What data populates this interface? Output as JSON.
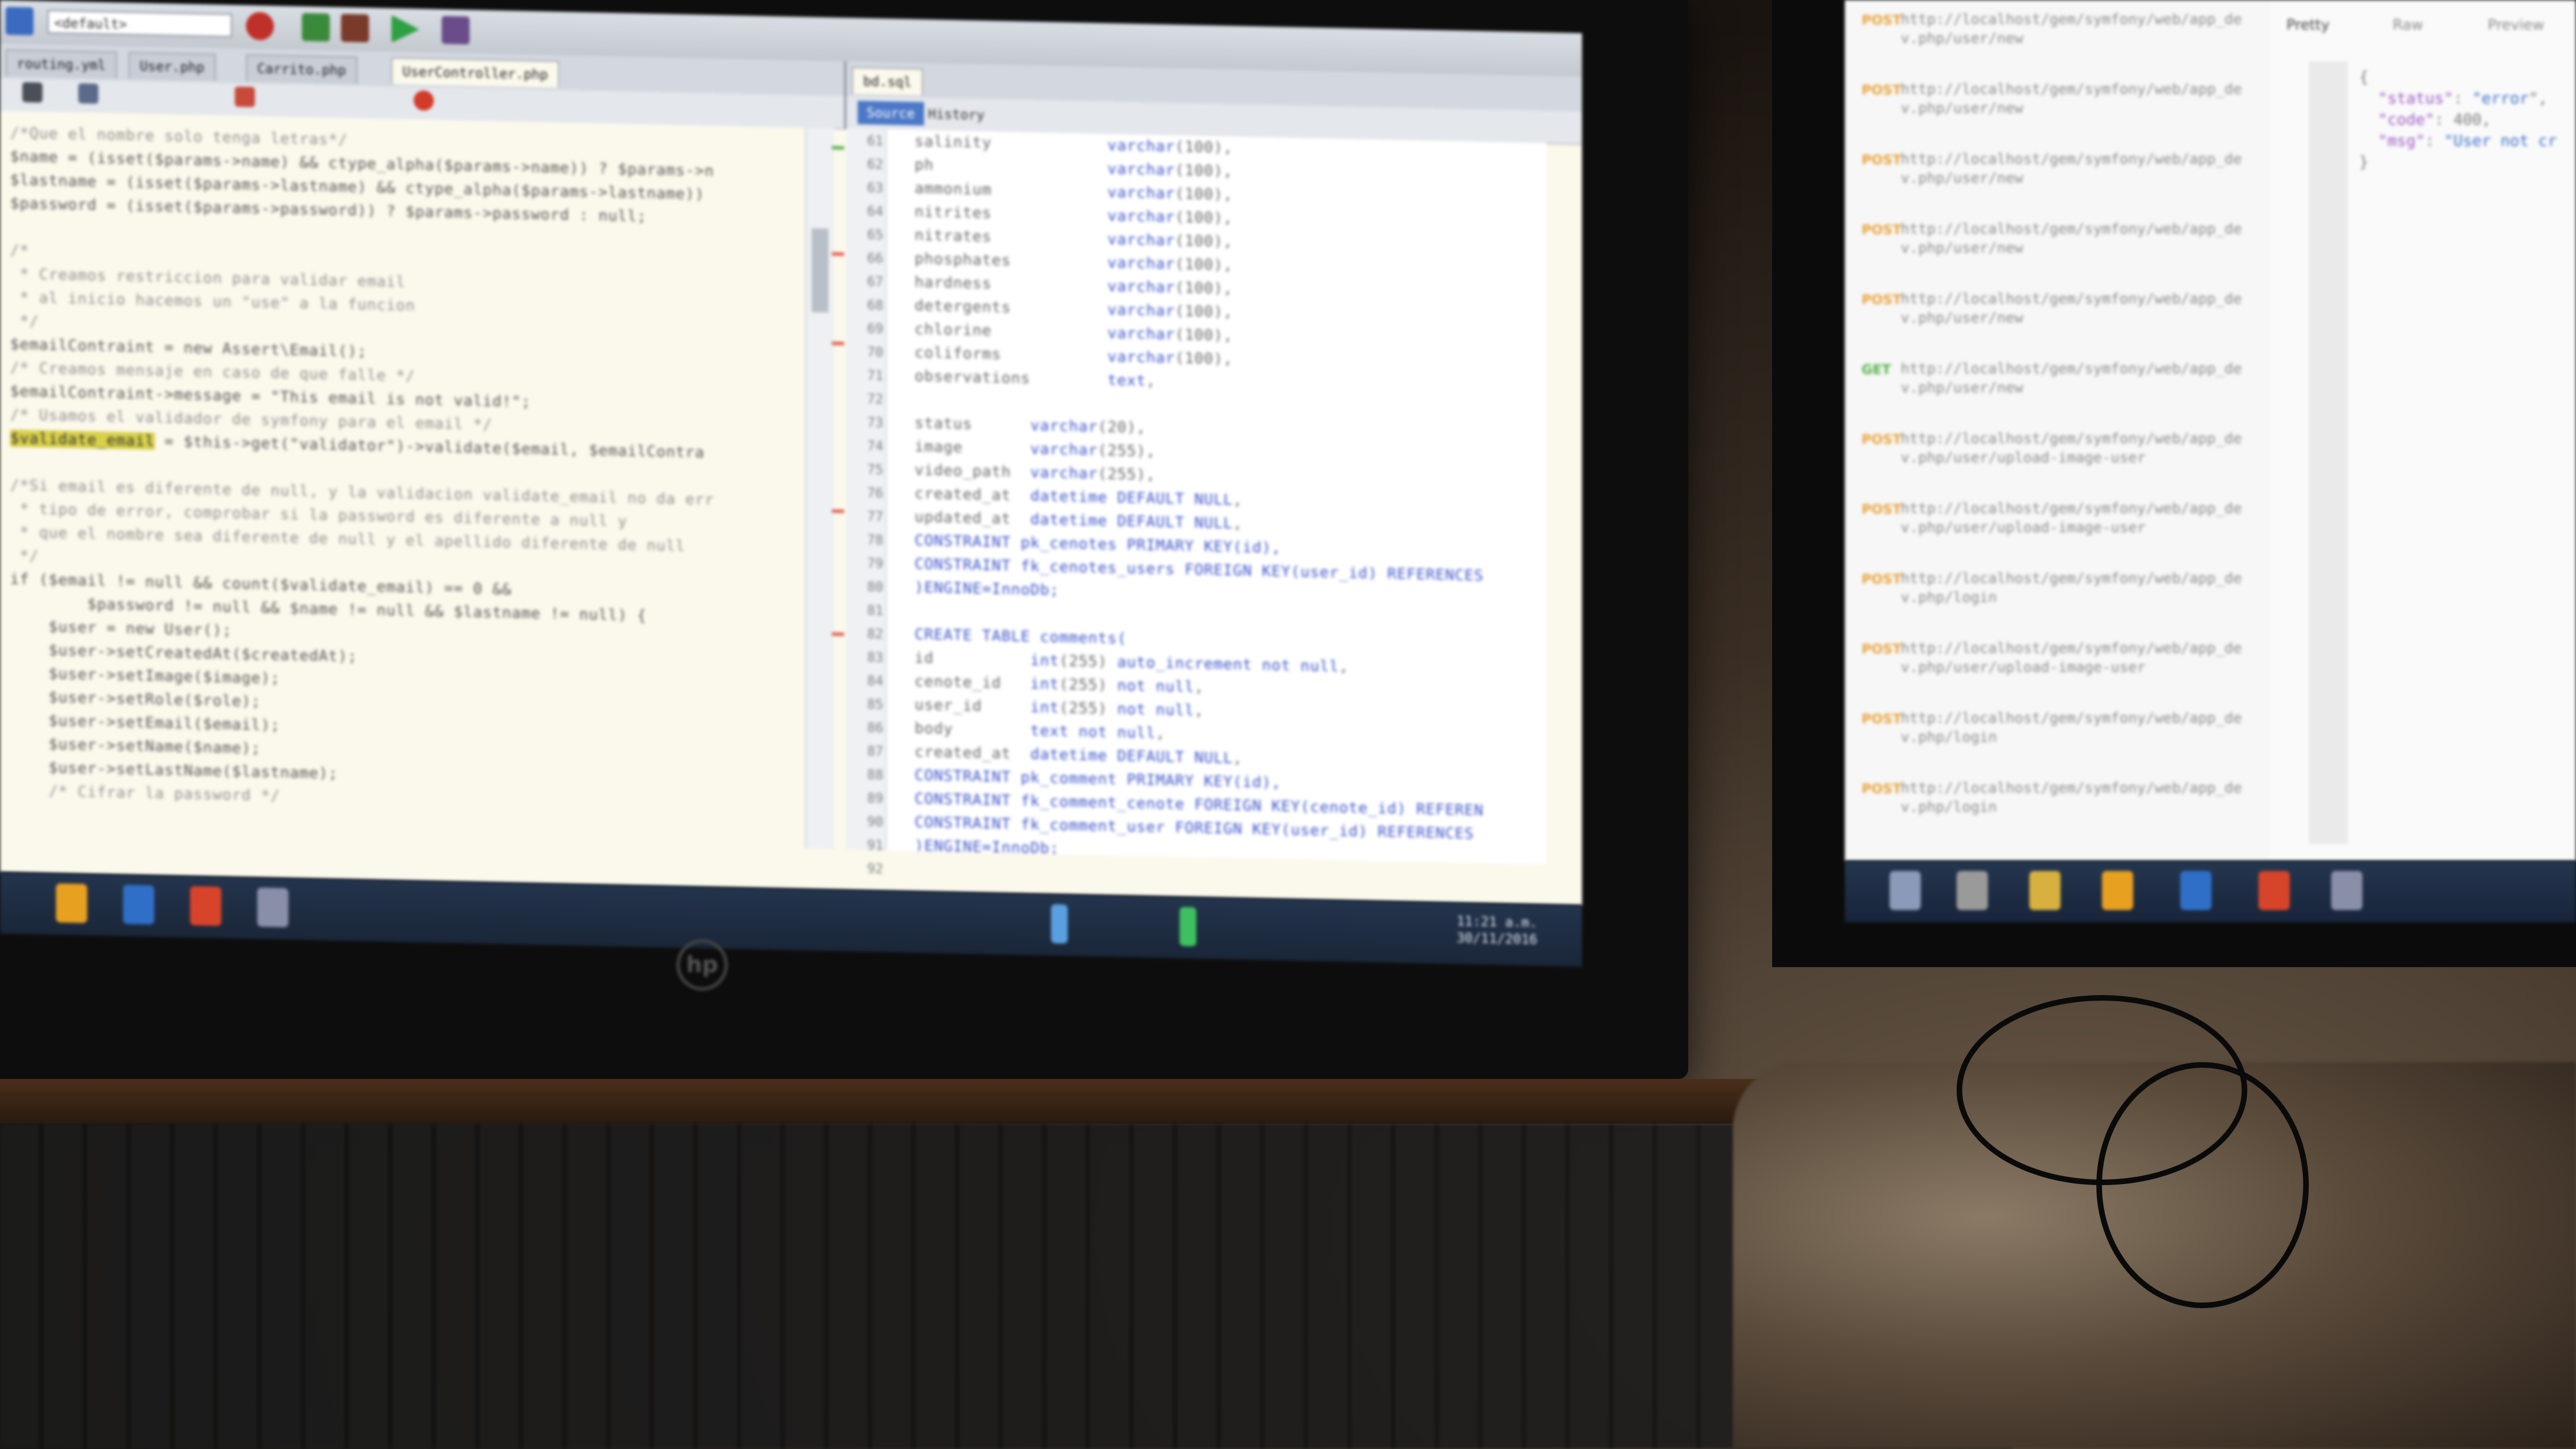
{
  "left_ide": {
    "toolbar": {
      "config_combo": "<default>"
    },
    "editor_tabs": [
      "routing.yml",
      "User.php",
      "Carrito.php",
      "UserController.php"
    ],
    "right_tab": "bd.sql",
    "subtabs": {
      "source": "Source",
      "history": "History"
    },
    "php_code": [
      {
        "text": "/*Que el nombre solo tenga letras*/",
        "style": "comment"
      },
      {
        "text": "$name = (isset($params->name) && ctype_alpha($params->name)) ? $params->n",
        "style": "plain"
      },
      {
        "text": "$lastname = (isset($params->lastname) && ctype_alpha($params->lastname))",
        "style": "plain"
      },
      {
        "text": "$password = (isset($params->password)) ? $params->password : null;",
        "style": "plain"
      },
      {
        "text": "",
        "style": "plain"
      },
      {
        "text": "/*",
        "style": "comment"
      },
      {
        "text": " * Creamos restriccion para validar email",
        "style": "comment"
      },
      {
        "text": " * al inicio hacemos un \"use\" a la funcion",
        "style": "comment"
      },
      {
        "text": " */",
        "style": "comment"
      },
      {
        "text": "$emailContraint = new Assert\\Email();",
        "style": "plain"
      },
      {
        "text": "/* Creamos mensaje en caso de que falle */",
        "style": "comment"
      },
      {
        "text": "$emailContraint->message = \"This email is not valid!\";",
        "style": "plain"
      },
      {
        "text": "/* Usamos el validador de symfony para el email */",
        "style": "comment"
      },
      {
        "text": "$validate_email = $this->get(\"validator\")->validate($email, $emailContra",
        "style": "plain"
      },
      {
        "text": "",
        "style": "plain"
      },
      {
        "text": "/*Si email es diferente de null, y la validacion validate_email no da err",
        "style": "comment"
      },
      {
        "text": " * tipo de error, comprobar si la password es diferente a null y",
        "style": "comment"
      },
      {
        "text": " * que el nombre sea diferente de null y el apellido diferente de null",
        "style": "comment"
      },
      {
        "text": " */",
        "style": "comment"
      },
      {
        "text": "if ($email != null && count($validate_email) == 0 &&",
        "style": "plain"
      },
      {
        "text": "        $password != null && $name != null && $lastname != null) {",
        "style": "plain"
      },
      {
        "text": "    $user = new User();",
        "style": "plain"
      },
      {
        "text": "    $user->setCreatedAt($createdAt);",
        "style": "plain"
      },
      {
        "text": "    $user->setImage($image);",
        "style": "plain"
      },
      {
        "text": "    $user->setRole($role);",
        "style": "plain"
      },
      {
        "text": "    $user->setEmail($email);",
        "style": "plain"
      },
      {
        "text": "    $user->setName($name);",
        "style": "plain"
      },
      {
        "text": "    $user->setLastName($lastname);",
        "style": "plain"
      },
      {
        "text": "    /* Cifrar la password */",
        "style": "comment"
      }
    ],
    "sql_line_numbers": [
      "61",
      "62",
      "63",
      "64",
      "65",
      "66",
      "67",
      "68",
      "69",
      "70",
      "71",
      "72",
      "73",
      "74",
      "75",
      "76",
      "77",
      "78",
      "79",
      "80",
      "81",
      "82",
      "83",
      "84",
      "85",
      "86",
      "87",
      "88",
      "89",
      "90",
      "91",
      "92"
    ],
    "sql_code": [
      "salinity            varchar(100),",
      "ph                  varchar(100),",
      "ammonium            varchar(100),",
      "nitrites            varchar(100),",
      "nitrates            varchar(100),",
      "phosphates          varchar(100),",
      "hardness            varchar(100),",
      "detergents          varchar(100),",
      "chlorine            varchar(100),",
      "coliforms           varchar(100),",
      "observations        text,",
      "",
      "status      varchar(20),",
      "image       varchar(255),",
      "video_path  varchar(255),",
      "created_at  datetime DEFAULT NULL,",
      "updated_at  datetime DEFAULT NULL,",
      "CONSTRAINT pk_cenotes PRIMARY KEY(id),",
      "CONSTRAINT fk_cenotes_users FOREIGN KEY(user_id) REFERENCES",
      ")ENGINE=InnoDb;",
      "",
      "CREATE TABLE comments(",
      "id          int(255) auto_increment not null,",
      "cenote_id   int(255) not null,",
      "user_id     int(255) not null,",
      "body        text not null,",
      "created_at  datetime DEFAULT NULL,",
      "CONSTRAINT pk_comment PRIMARY KEY(id),",
      "CONSTRAINT fk_comment_cenote FOREIGN KEY(cenote_id) REFEREN",
      "CONSTRAINT fk_comment_user FOREIGN KEY(user_id) REFERENCES",
      ")ENGINE=InnoDb;",
      ""
    ],
    "clock": {
      "time": "11:21 a.m.",
      "date": "30/11/2016"
    }
  },
  "right_app": {
    "requests": [
      {
        "method": "POST",
        "url": "http://localhost/gem/symfony/web/app_dev.php/user/new"
      },
      {
        "method": "POST",
        "url": "http://localhost/gem/symfony/web/app_dev.php/user/new"
      },
      {
        "method": "POST",
        "url": "http://localhost/gem/symfony/web/app_dev.php/user/new"
      },
      {
        "method": "POST",
        "url": "http://localhost/gem/symfony/web/app_dev.php/user/new"
      },
      {
        "method": "POST",
        "url": "http://localhost/gem/symfony/web/app_dev.php/user/new"
      },
      {
        "method": "GET",
        "url": "http://localhost/gem/symfony/web/app_dev.php/user/new"
      },
      {
        "method": "POST",
        "url": "http://localhost/gem/symfony/web/app_dev.php/user/upload-image-user"
      },
      {
        "method": "POST",
        "url": "http://localhost/gem/symfony/web/app_dev.php/user/upload-image-user"
      },
      {
        "method": "POST",
        "url": "http://localhost/gem/symfony/web/app_dev.php/login"
      },
      {
        "method": "POST",
        "url": "http://localhost/gem/symfony/web/app_dev.php/user/upload-image-user"
      },
      {
        "method": "POST",
        "url": "http://localhost/gem/symfony/web/app_dev.php/login"
      },
      {
        "method": "POST",
        "url": "http://localhost/gem/symfony/web/app_dev.php/login"
      }
    ],
    "response_tabs": [
      "Pretty",
      "Raw",
      "Preview"
    ],
    "json_lines": [
      "{",
      "  \"status\": \"error\",",
      "  \"code\": 400,",
      "  \"msg\": \"User not cr",
      "}"
    ]
  },
  "colors": {
    "editor_bg": "#fbf9ec",
    "keyword": "#3a52c8",
    "highlight": "#d9d04a",
    "taskbar": "#1a2638"
  },
  "brand": "hp"
}
